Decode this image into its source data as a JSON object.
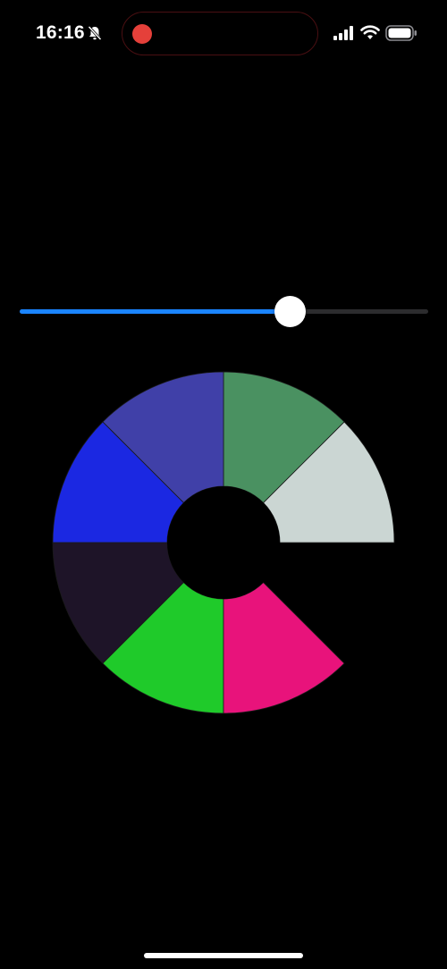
{
  "status_bar": {
    "time": "16:16",
    "recording_color": "#e5403a",
    "icons": [
      "bell-slash-icon",
      "cellular-signal-icon",
      "wifi-icon",
      "battery-icon"
    ]
  },
  "slider": {
    "value": 0.66,
    "fill_color": "#1a84ff",
    "track_color": "#2c2c2e",
    "thumb_color": "#ffffff"
  },
  "wheel": {
    "segment_count": 8,
    "start": "east",
    "direction": "counter-clockwise",
    "segments": [
      {
        "color": "#cbd6d3"
      },
      {
        "color": "#4a9161"
      },
      {
        "color": "#4040a8"
      },
      {
        "color": "#1b28e2"
      },
      {
        "color": "#1e1428"
      },
      {
        "color": "#1fca2a"
      },
      {
        "color": "#e8137b"
      }
    ]
  }
}
